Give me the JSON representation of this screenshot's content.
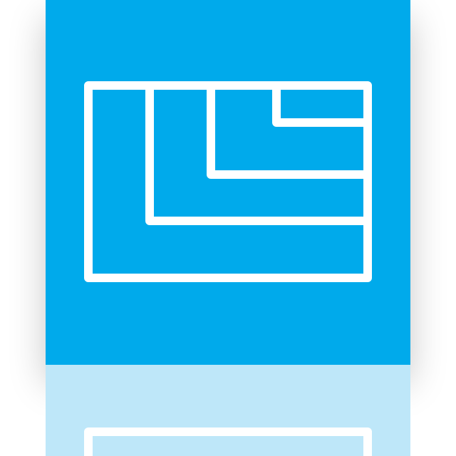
{
  "app_icon": {
    "icon_name": "layout-columns-icon",
    "colors": {
      "tile": "#00AAEB",
      "glyph": "#FFFFFF",
      "reflection_tile": "#BEE7F9"
    }
  }
}
